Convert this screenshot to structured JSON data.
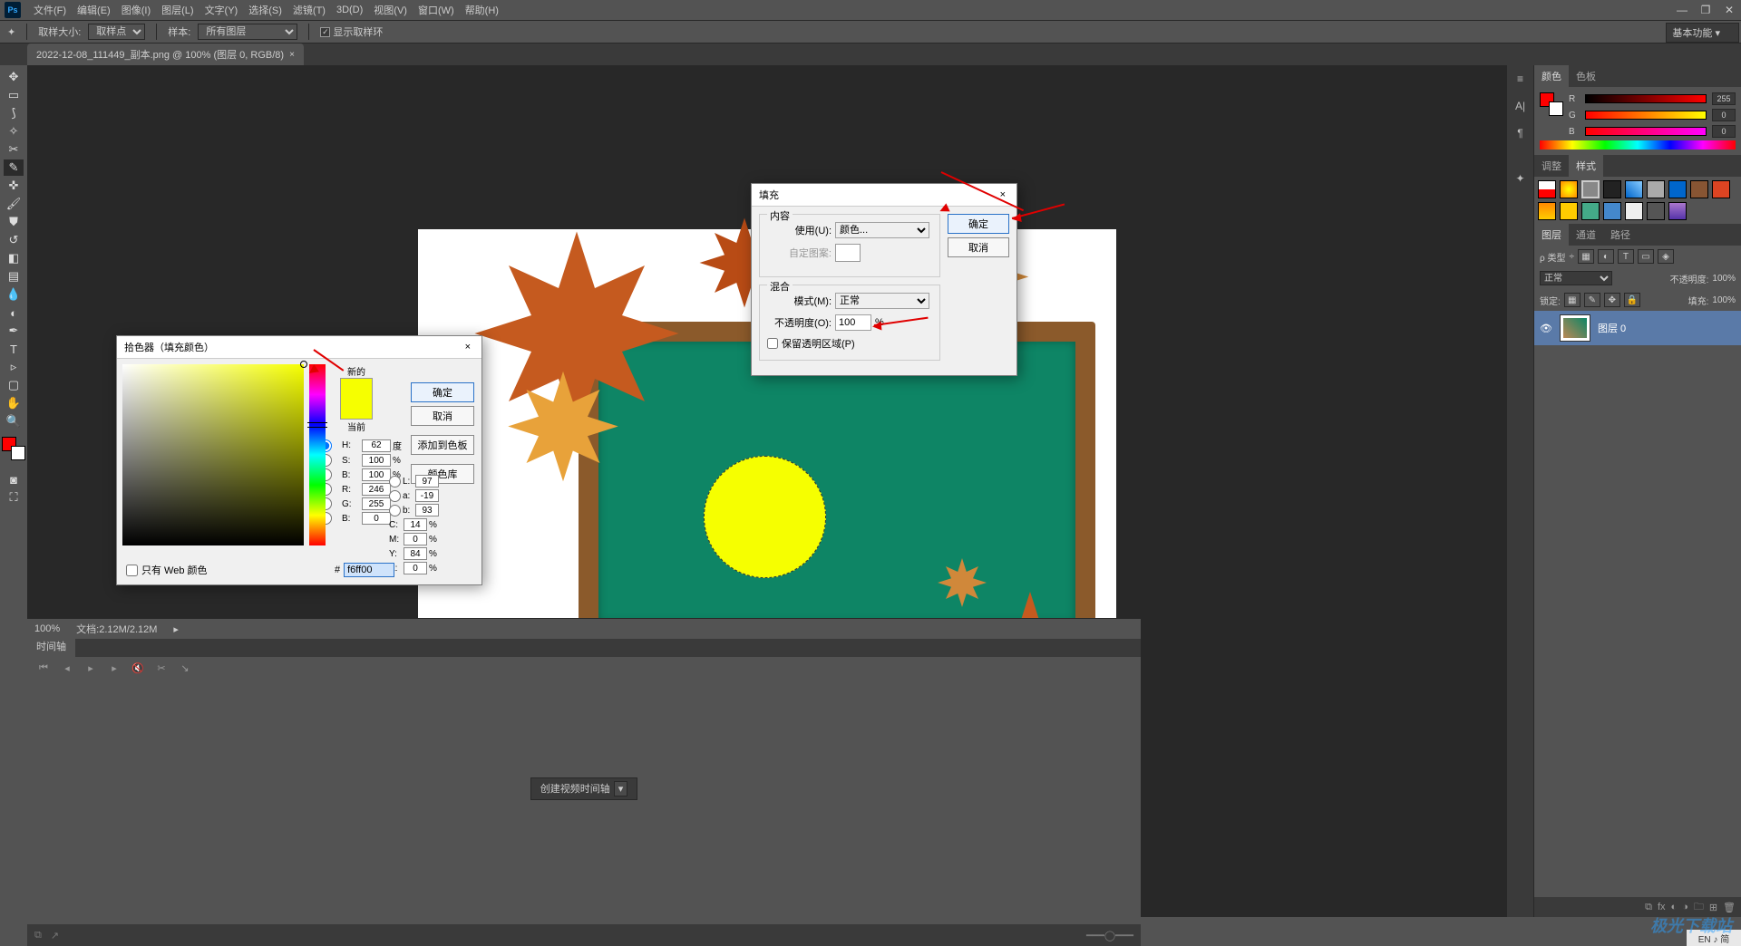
{
  "menubar": {
    "app": "Ps",
    "items": [
      "文件(F)",
      "编辑(E)",
      "图像(I)",
      "图层(L)",
      "文字(Y)",
      "选择(S)",
      "滤镜(T)",
      "3D(D)",
      "视图(V)",
      "窗口(W)",
      "帮助(H)"
    ]
  },
  "window_controls": [
    "—",
    "❐",
    "✕"
  ],
  "options_bar": {
    "tool_icon": "✦",
    "sample_size_label": "取样大小:",
    "sample_size_value": "取样点",
    "sample_source_label": "样本:",
    "sample_source_value": "所有图层",
    "show_ring_label": "显示取样环",
    "show_ring_checked": true,
    "workspace_mode": "基本功能"
  },
  "document_tab": {
    "title": "2022-12-08_111449_副本.png @ 100% (图层 0, RGB/8)",
    "close": "×"
  },
  "status": {
    "zoom": "100%",
    "doc_size": "文档:2.12M/2.12M"
  },
  "timeline": {
    "tab": "时间轴",
    "create_button": "创建视频时间轴"
  },
  "right_panels": {
    "color": {
      "tab": "颜色",
      "tab2": "色板",
      "sliders": [
        {
          "label": "R",
          "val": "255",
          "gradient": "linear-gradient(90deg,#000,#f00)"
        },
        {
          "label": "G",
          "val": "0",
          "gradient": "linear-gradient(90deg,#000,#0f0)"
        },
        {
          "label": "B",
          "val": "0",
          "gradient": "linear-gradient(90deg,#000,#00f)"
        }
      ]
    },
    "adjust": {
      "tab1": "调整",
      "tab2": "样式"
    },
    "layers": {
      "tab1": "图层",
      "tab2": "通道",
      "tab3": "路径",
      "filter_label": "ρ 类型",
      "blend_mode": "正常",
      "opacity_label": "不透明度:",
      "opacity_value": "100%",
      "lock_label": "锁定:",
      "fill_label": "填充:",
      "fill_value": "100%",
      "layer_name": "图层 0"
    }
  },
  "fill_dialog": {
    "title": "填充",
    "close": "×",
    "content_legend": "内容",
    "use_label": "使用(U):",
    "use_value": "颜色...",
    "pattern_label": "自定图案:",
    "blend_legend": "混合",
    "mode_label": "模式(M):",
    "mode_value": "正常",
    "opacity_label": "不透明度(O):",
    "opacity_value": "100",
    "opacity_unit": "%",
    "preserve_label": "保留透明区域(P)",
    "ok": "确定",
    "cancel": "取消"
  },
  "color_picker": {
    "title": "拾色器（填充颜色）",
    "close": "×",
    "new_label": "新的",
    "current_label": "当前",
    "ok": "确定",
    "cancel": "取消",
    "add_swatch": "添加到色板",
    "libraries": "颜色库",
    "fields": {
      "H": "62",
      "H_unit": "度",
      "S": "100",
      "S_unit": "%",
      "B": "100",
      "B_unit": "%",
      "R": "246",
      "G": "255",
      "Bv": "0",
      "L": "97",
      "a": "-19",
      "b": "93",
      "C": "14",
      "M": "0",
      "Y": "84",
      "K": "0"
    },
    "web_only_label": "只有 Web 颜色",
    "hex_label": "#",
    "hex_value": "f6ff00",
    "new_color": "#f6ff00",
    "current_color": "#f6ff00"
  }
}
